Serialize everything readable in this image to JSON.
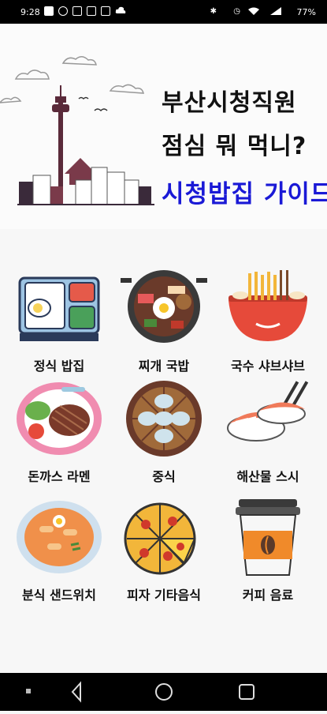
{
  "status_bar": {
    "time": "9:28",
    "battery": "77%"
  },
  "header": {
    "line1": "부산시청직원",
    "line2": "점심 뭐 먹니?",
    "line3": "시청밥집 가이드"
  },
  "menu": [
    {
      "label": "정식 밥집",
      "icon": "lunchbox-icon"
    },
    {
      "label": "찌개 국밥",
      "icon": "stew-pan-icon"
    },
    {
      "label": "국수 샤브샤브",
      "icon": "noodle-bowl-icon"
    },
    {
      "label": "돈까스 라멘",
      "icon": "cutlet-plate-icon"
    },
    {
      "label": "중식",
      "icon": "dumpling-steamer-icon"
    },
    {
      "label": "해산물 스시",
      "icon": "sushi-icon"
    },
    {
      "label": "분식 샌드위치",
      "icon": "tteokbokki-icon"
    },
    {
      "label": "피자 기타음식",
      "icon": "pizza-icon"
    },
    {
      "label": "커피 음료",
      "icon": "coffee-cup-icon"
    }
  ]
}
